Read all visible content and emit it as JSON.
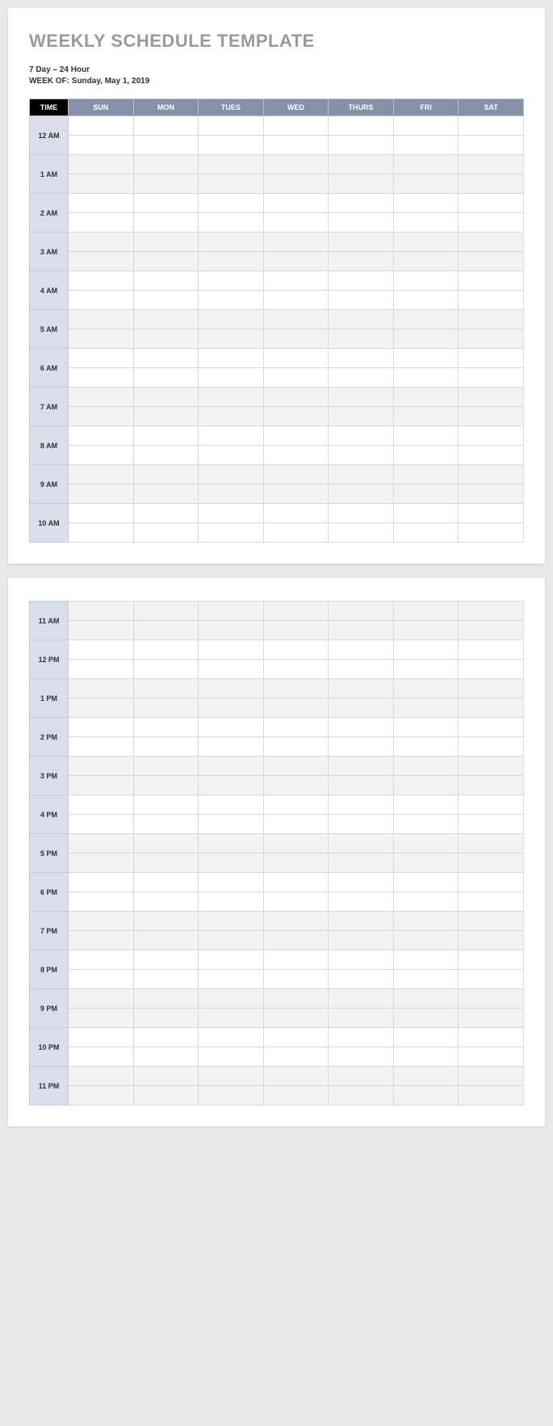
{
  "title": "WEEKLY SCHEDULE TEMPLATE",
  "meta_line1": "7 Day – 24 Hour",
  "meta_line2": "WEEK OF: Sunday, May 1, 2019",
  "columns": {
    "time": "TIME",
    "days": [
      "SUN",
      "MON",
      "TUES",
      "WED",
      "THURS",
      "FRI",
      "SAT"
    ]
  },
  "page1_hours": [
    "12 AM",
    "1 AM",
    "2 AM",
    "3 AM",
    "4 AM",
    "5 AM",
    "6 AM",
    "7 AM",
    "8 AM",
    "9 AM",
    "10 AM"
  ],
  "page2_hours": [
    "11 AM",
    "12 PM",
    "1 PM",
    "2 PM",
    "3 PM",
    "4 PM",
    "5 PM",
    "6 PM",
    "7 PM",
    "8 PM",
    "9 PM",
    "10 PM",
    "11 PM"
  ]
}
